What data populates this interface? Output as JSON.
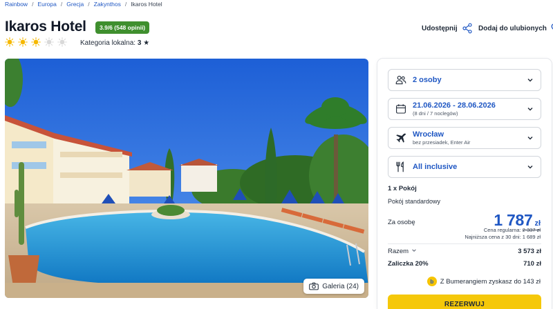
{
  "breadcrumb": [
    "Rainbow",
    "Europa",
    "Grecja",
    "Zakynthos",
    "Ikaros Hotel"
  ],
  "hotel": {
    "name": "Ikaros Hotel",
    "rating_badge": "3.9/6 (548 opinii)",
    "suns_total": 5,
    "suns_filled": 3,
    "local_category_label": "Kategoria lokalna:",
    "local_category_value": "3"
  },
  "actions": {
    "share_label": "Udostępnij",
    "favorite_label": "Dodaj do ulubionych"
  },
  "gallery": {
    "label": "Galeria (24)"
  },
  "booking": {
    "guests": "2 osoby",
    "dates": "21.06.2026 - 28.06.2026",
    "dates_sub": "(8 dni / 7 noclegów)",
    "departure": "Wrocław",
    "departure_sub": "bez przesiadek, Enter Air",
    "board": "All inclusive",
    "room_count": "1 x Pokój",
    "room_type": "Pokój standardowy",
    "per_person_label": "Za osobę",
    "price": "1 787",
    "currency": "zł",
    "regular_price_label": "Cena regularna:",
    "regular_price": "2 337 zł",
    "lowest_price": "Najniższa cena z 30 dni: 1 689 zł",
    "total_label": "Razem",
    "total_value": "3 573 zł",
    "deposit_label": "Zaliczka 20%",
    "deposit_value": "710 zł",
    "boomerang_text": "Z Bumerangiem zyskasz do 143 zł",
    "reserve_label": "REZERWUJ"
  },
  "colors": {
    "accent_blue": "#1f57c3",
    "rating_green": "#3f8f2e",
    "cta_yellow": "#f5c80a",
    "sun_yellow": "#f6b800"
  }
}
